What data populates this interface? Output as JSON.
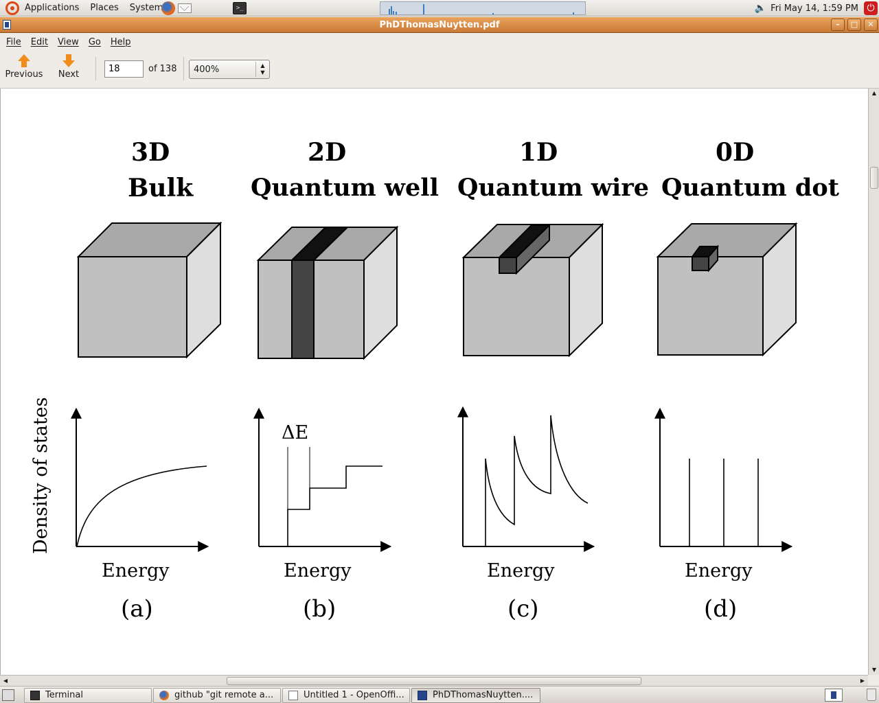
{
  "top_panel": {
    "menus": [
      "Applications",
      "Places",
      "System"
    ],
    "clock": "Fri May 14,  1:59 PM"
  },
  "window": {
    "title": "PhDThomasNuytten.pdf"
  },
  "menubar": {
    "items": [
      "File",
      "Edit",
      "View",
      "Go",
      "Help"
    ]
  },
  "toolbar": {
    "previous_label": "Previous",
    "next_label": "Next",
    "page_value": "18",
    "page_total": "of 138",
    "zoom_value": "400%"
  },
  "figure": {
    "columns": [
      {
        "dim": "3D",
        "name": "Bulk",
        "xlabel": "Energy",
        "caption": "(a)"
      },
      {
        "dim": "2D",
        "name": "Quantum well",
        "xlabel": "Energy",
        "caption": "(b)"
      },
      {
        "dim": "1D",
        "name": "Quantum wire",
        "xlabel": "Energy",
        "caption": "(c)"
      },
      {
        "dim": "0D",
        "name": "Quantum dot",
        "xlabel": "Energy",
        "caption": "(d)"
      }
    ],
    "ylabel": "Density of states",
    "delta_label": "ΔE"
  },
  "taskbar": {
    "tasks": [
      "Terminal",
      "github \"git remote a...",
      "Untitled 1 - OpenOffi...",
      "PhDThomasNuytten...."
    ]
  },
  "icons": {
    "up_arrow": "up-arrow-icon",
    "down_arrow": "down-arrow-icon",
    "power": "power-icon",
    "volume": "volume-icon"
  },
  "colors": {
    "title_bar": "#d88a45",
    "cube_front": "#c0c0c0",
    "cube_top": "#a9a9a9",
    "cube_side": "#dedede",
    "dark_block": "#444444"
  }
}
